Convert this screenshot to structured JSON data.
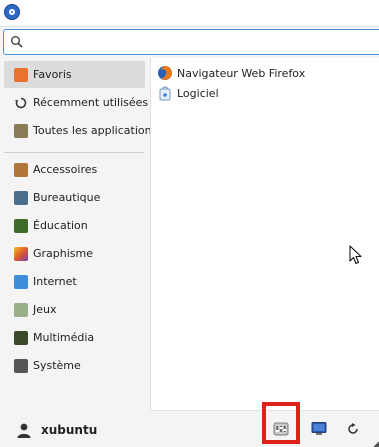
{
  "search": {
    "value": "",
    "placeholder": ""
  },
  "sidebar": {
    "items": [
      {
        "label": "Favoris",
        "icon": "favorites-icon",
        "color": "#e8732c"
      },
      {
        "label": "Récemment utilisées",
        "icon": "recent-icon",
        "color": "#444444"
      },
      {
        "label": "Toutes les applications",
        "icon": "all-apps-icon",
        "color": "#6a5a3a"
      },
      {
        "label": "Accessoires",
        "icon": "accessories-icon",
        "color": "#b0763a"
      },
      {
        "label": "Bureautique",
        "icon": "office-icon",
        "color": "#4a6f8c"
      },
      {
        "label": "Éducation",
        "icon": "education-icon",
        "color": "#3f6b2a"
      },
      {
        "label": "Graphisme",
        "icon": "graphics-icon",
        "color": "#e05a2a"
      },
      {
        "label": "Internet",
        "icon": "internet-icon",
        "color": "#3b8fd9"
      },
      {
        "label": "Jeux",
        "icon": "games-icon",
        "color": "#7a9a6a"
      },
      {
        "label": "Multimédia",
        "icon": "multimedia-icon",
        "color": "#3a4a2a"
      },
      {
        "label": "Système",
        "icon": "system-icon",
        "color": "#555555"
      }
    ]
  },
  "apps": [
    {
      "label": "Navigateur Web Firefox",
      "icon": "firefox-icon"
    },
    {
      "label": "Logiciel",
      "icon": "software-icon"
    }
  ],
  "user": {
    "name": "xubuntu"
  },
  "colors": {
    "accent": "#4a90d9",
    "highlight": "#e0211b",
    "active_item": "#dcdcdc"
  }
}
